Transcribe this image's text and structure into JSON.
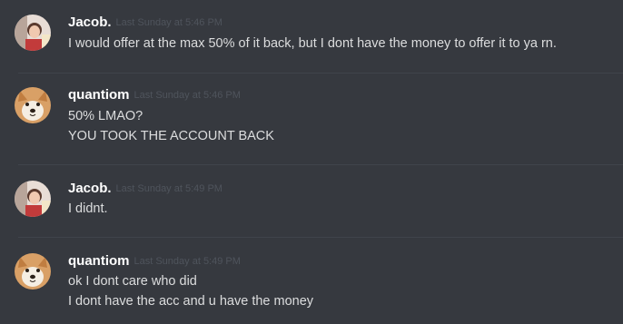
{
  "messages": [
    {
      "author": "Jacob.",
      "avatar": "jacob-avatar",
      "timestamp": "Last Sunday at 5:46 PM",
      "lines": [
        "I would offer at the max 50% of it back, but I dont have the money to offer it to ya rn."
      ]
    },
    {
      "author": "quantiom",
      "avatar": "shiba-avatar",
      "timestamp": "Last Sunday at 5:46 PM",
      "lines": [
        "50% LMAO?",
        "YOU TOOK THE ACCOUNT BACK"
      ]
    },
    {
      "author": "Jacob.",
      "avatar": "jacob-avatar",
      "timestamp": "Last Sunday at 5:49 PM",
      "lines": [
        "I didnt."
      ]
    },
    {
      "author": "quantiom",
      "avatar": "shiba-avatar",
      "timestamp": "Last Sunday at 5:49 PM",
      "lines": [
        "ok I dont care who did",
        "I dont have the acc and u have the money"
      ]
    }
  ],
  "colors": {
    "background": "#36393f",
    "username": "#ffffff",
    "timestamp": "#4f545c",
    "text": "#dcddde",
    "divider": "#40444b"
  }
}
